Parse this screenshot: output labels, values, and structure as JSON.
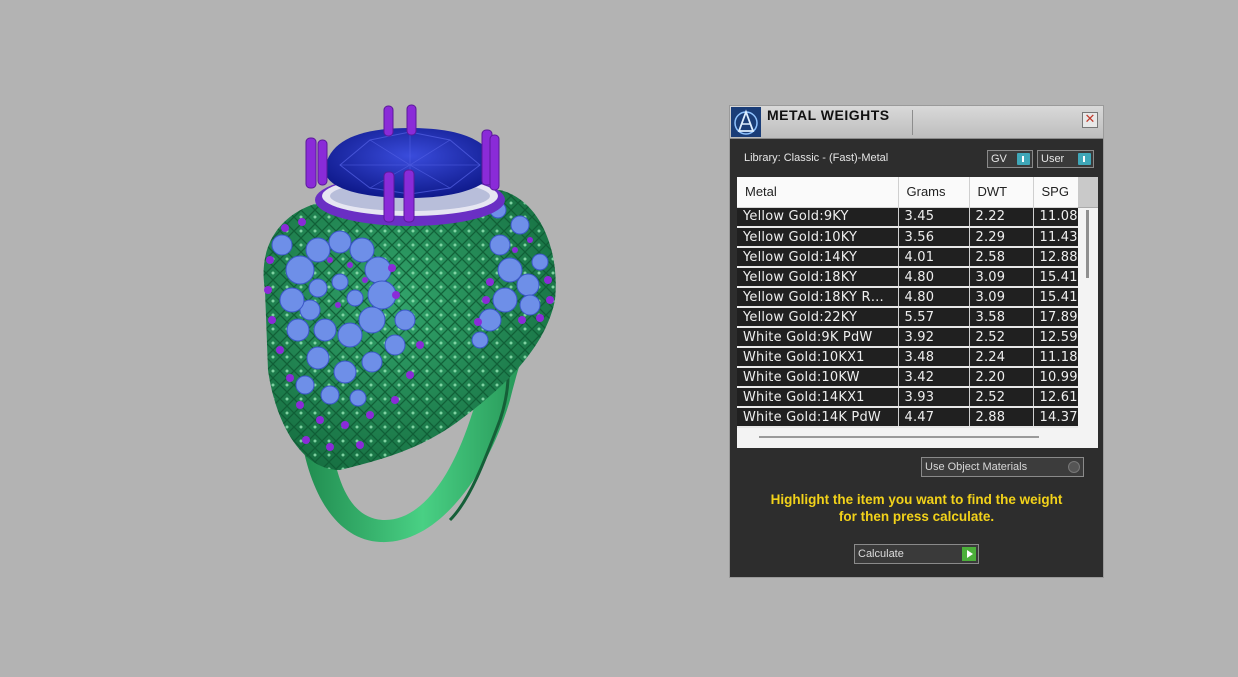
{
  "panel": {
    "title": "METAL WEIGHTS",
    "close_glyph": "✕",
    "library_label": "Library: Classic - (Fast)-Metal",
    "toggle_gv": "GV",
    "toggle_user": "User",
    "use_object_materials": "Use Object Materials",
    "hint_line1": "Highlight the item you want to find the weight",
    "hint_line2": "for then press calculate.",
    "calculate_label": "Calculate"
  },
  "table": {
    "columns": [
      "Metal",
      "Grams",
      "DWT",
      "SPG"
    ],
    "rows": [
      [
        "Yellow Gold:9KY",
        "3.45",
        "2.22",
        "11.08"
      ],
      [
        "Yellow Gold:10KY",
        "3.56",
        "2.29",
        "11.43"
      ],
      [
        "Yellow Gold:14KY",
        "4.01",
        "2.58",
        "12.88"
      ],
      [
        "Yellow Gold:18KY",
        "4.80",
        "3.09",
        "15.41"
      ],
      [
        "Yellow Gold:18KY R…",
        "4.80",
        "3.09",
        "15.41"
      ],
      [
        "Yellow Gold:22KY",
        "5.57",
        "3.58",
        "17.89"
      ],
      [
        "White Gold:9K PdW",
        "3.92",
        "2.52",
        "12.59"
      ],
      [
        "White Gold:10KX1",
        "3.48",
        "2.24",
        "11.18"
      ],
      [
        "White Gold:10KW",
        "3.42",
        "2.20",
        "10.99"
      ],
      [
        "White Gold:14KX1",
        "3.93",
        "2.52",
        "12.61"
      ],
      [
        "White Gold:14K PdW",
        "4.47",
        "2.88",
        "14.37"
      ]
    ]
  },
  "colors": {
    "ring_metal": "#2aa160",
    "gem": "#1f2fb5",
    "prongs": "#8a2bd8",
    "stones": "#6e8fe8",
    "hint_text": "#f2d21a",
    "toggle_knob": "#3fa7b8",
    "calc_arrow": "#4caf3a"
  },
  "icons": {
    "logo": "app-logo-icon",
    "close": "close-icon",
    "calculate": "play-arrow-icon"
  }
}
